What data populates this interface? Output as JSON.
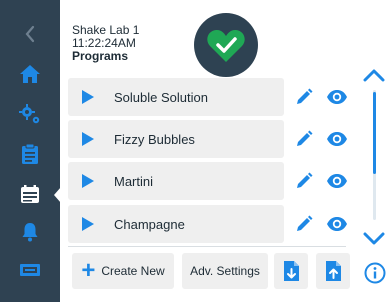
{
  "header": {
    "device_name": "Shake Lab 1",
    "time": "11:22:24AM",
    "section": "Programs"
  },
  "status": {
    "icon": "heart-check-icon",
    "color": "#1fa855"
  },
  "sidebar": {
    "items": [
      {
        "icon": "back-chevron-icon"
      },
      {
        "icon": "home-icon"
      },
      {
        "icon": "settings-gears-icon"
      },
      {
        "icon": "clipboard-icon"
      },
      {
        "icon": "calendar-programs-icon",
        "active": true
      },
      {
        "icon": "bell-icon"
      },
      {
        "icon": "display-icon"
      }
    ]
  },
  "programs": [
    {
      "name": "Soluble Solution"
    },
    {
      "name": "Fizzy Bubbles"
    },
    {
      "name": "Martini"
    },
    {
      "name": "Champagne"
    }
  ],
  "toolbar": {
    "create_label": "Create New",
    "adv_label": "Adv. Settings",
    "import_icon": "file-import-icon",
    "export_icon": "file-export-icon"
  },
  "colors": {
    "accent": "#1e88e5",
    "sidebar": "#2f4252",
    "status_green": "#1fa855"
  }
}
